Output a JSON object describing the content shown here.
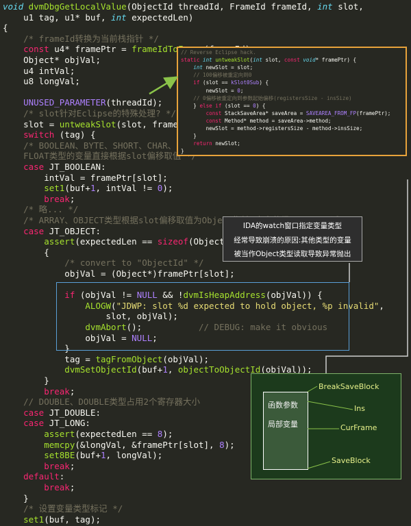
{
  "code_lines": [
    [
      [
        "ty",
        "void "
      ],
      [
        "fn",
        "dvmDbgGetLocalValue"
      ],
      [
        "tx",
        "(ObjectId threadId, FrameId frameId, "
      ],
      [
        "ty",
        "int"
      ],
      [
        "tx",
        " slot,"
      ]
    ],
    [
      [
        "tx",
        "    u1 tag, u1* buf, "
      ],
      [
        "ty",
        "int"
      ],
      [
        "tx",
        " expectedLen)"
      ]
    ],
    [
      [
        "tx",
        "{"
      ]
    ],
    [
      [
        "cm",
        "    /* frameId转换为当前栈指针 */"
      ]
    ],
    [
      [
        "kw",
        "    const "
      ],
      [
        "tx",
        "u4* framePtr = "
      ],
      [
        "fn",
        "frameIdToFrame"
      ],
      [
        "tx",
        "(frameId);"
      ]
    ],
    [
      [
        "tx",
        "    Object* objVal;"
      ]
    ],
    [
      [
        "tx",
        "    u4 intVal;"
      ]
    ],
    [
      [
        "tx",
        "    u8 longVal;"
      ]
    ],
    [
      [
        "tx",
        ""
      ]
    ],
    [
      [
        "mac",
        "    UNUSED_PARAMETER"
      ],
      [
        "tx",
        "(threadId);"
      ]
    ],
    [
      [
        "cm",
        "    /* slot针对Eclipse的特殊处理? */"
      ]
    ],
    [
      [
        "tx",
        "    slot = "
      ],
      [
        "fn",
        "untweakSlot"
      ],
      [
        "tx",
        "(slot, framePtr);"
      ]
    ],
    [
      [
        "kw",
        "    switch "
      ],
      [
        "tx",
        "(tag) {"
      ]
    ],
    [
      [
        "cm",
        "    /* BOOLEAN、BYTE、SHORT、CHAR、INT"
      ]
    ],
    [
      [
        "cm",
        "    FLOAT类型的变量直接根据slot偏移取值 */"
      ]
    ],
    [
      [
        "kw",
        "    case "
      ],
      [
        "tx",
        "JT_BOOLEAN:"
      ]
    ],
    [
      [
        "tx",
        "        intVal = framePtr[slot];"
      ]
    ],
    [
      [
        "fn",
        "        set1"
      ],
      [
        "tx",
        "(buf+"
      ],
      [
        "num",
        "1"
      ],
      [
        "tx",
        ", intVal != "
      ],
      [
        "num",
        "0"
      ],
      [
        "tx",
        ");"
      ]
    ],
    [
      [
        "kw",
        "        break"
      ],
      [
        "tx",
        ";"
      ]
    ],
    [
      [
        "cm",
        "    /* 略... */"
      ]
    ],
    [
      [
        "cm",
        "    /* ARRAY、OBJECT类型根据slot偏移取值为Object指针,查表获得ObjectId返回 */"
      ]
    ],
    [
      [
        "kw",
        "    case "
      ],
      [
        "tx",
        "JT_OBJECT:"
      ]
    ],
    [
      [
        "fn",
        "        assert"
      ],
      [
        "tx",
        "(expectedLen == "
      ],
      [
        "kw",
        "sizeof"
      ],
      [
        "tx",
        "(ObjectId));"
      ]
    ],
    [
      [
        "tx",
        "        {"
      ]
    ],
    [
      [
        "cm",
        "            /* convert to \"ObjectId\" */"
      ]
    ],
    [
      [
        "tx",
        "            objVal = (Object*)framePtr[slot];"
      ]
    ],
    [
      [
        "tx",
        ""
      ]
    ],
    [
      [
        "kw",
        "            if "
      ],
      [
        "tx",
        "(objVal != "
      ],
      [
        "num",
        "NULL"
      ],
      [
        "tx",
        " && !"
      ],
      [
        "fn",
        "dvmIsHeapAddress"
      ],
      [
        "tx",
        "(objVal)) {"
      ]
    ],
    [
      [
        "fn",
        "                ALOGW"
      ],
      [
        "tx",
        "("
      ],
      [
        "str",
        "\"JDWP: slot %d expected to hold object, %p invalid\""
      ],
      [
        "tx",
        ","
      ]
    ],
    [
      [
        "tx",
        "                    slot, objVal);"
      ]
    ],
    [
      [
        "fn",
        "                dvmAbort"
      ],
      [
        "tx",
        "();           "
      ],
      [
        "cm",
        "// DEBUG: make it obvious"
      ]
    ],
    [
      [
        "tx",
        "                objVal = "
      ],
      [
        "num",
        "NULL"
      ],
      [
        "tx",
        ";"
      ]
    ],
    [
      [
        "tx",
        "            }"
      ]
    ],
    [
      [
        "tx",
        "            tag = "
      ],
      [
        "fn",
        "tagFromObject"
      ],
      [
        "tx",
        "(objVal);"
      ]
    ],
    [
      [
        "fn",
        "            dvmSetObjectId"
      ],
      [
        "tx",
        "(buf+"
      ],
      [
        "num",
        "1"
      ],
      [
        "tx",
        ", "
      ],
      [
        "fn",
        "objectToObjectId"
      ],
      [
        "tx",
        "(objVal));"
      ]
    ],
    [
      [
        "tx",
        "        }"
      ]
    ],
    [
      [
        "kw",
        "        break"
      ],
      [
        "tx",
        ";"
      ]
    ],
    [
      [
        "cm",
        "    // DOUBLE、DOUBLE类型占用2个寄存器大小"
      ]
    ],
    [
      [
        "kw",
        "    case "
      ],
      [
        "tx",
        "JT_DOUBLE:"
      ]
    ],
    [
      [
        "kw",
        "    case "
      ],
      [
        "tx",
        "JT_LONG:"
      ]
    ],
    [
      [
        "fn",
        "        assert"
      ],
      [
        "tx",
        "(expectedLen == "
      ],
      [
        "num",
        "8"
      ],
      [
        "tx",
        ");"
      ]
    ],
    [
      [
        "fn",
        "        memcpy"
      ],
      [
        "tx",
        "(&longVal, &framePtr[slot], "
      ],
      [
        "num",
        "8"
      ],
      [
        "tx",
        ");"
      ]
    ],
    [
      [
        "fn",
        "        set8BE"
      ],
      [
        "tx",
        "(buf+"
      ],
      [
        "num",
        "1"
      ],
      [
        "tx",
        ", longVal);"
      ]
    ],
    [
      [
        "kw",
        "        break"
      ],
      [
        "tx",
        ";"
      ]
    ],
    [
      [
        "kw",
        "    default"
      ],
      [
        "tx",
        ":"
      ]
    ],
    [
      [
        "kw",
        "        break"
      ],
      [
        "tx",
        ";"
      ]
    ],
    [
      [
        "tx",
        "    }"
      ]
    ],
    [
      [
        "cm",
        "    /* 设置变量类型标记 */"
      ]
    ],
    [
      [
        "fn",
        "    set1"
      ],
      [
        "tx",
        "(buf, tag);"
      ]
    ]
  ],
  "inset_lines": [
    [
      [
        "cm",
        "// Reverse Eclipse hack."
      ]
    ],
    [
      [
        "kw",
        "static "
      ],
      [
        "ty",
        "int "
      ],
      [
        "fn",
        "untweakSlot"
      ],
      [
        "tx",
        "("
      ],
      [
        "ty",
        "int"
      ],
      [
        "tx",
        " slot, "
      ],
      [
        "kw",
        "const "
      ],
      [
        "ty",
        "void"
      ],
      [
        "tx",
        "* framePtr) {"
      ]
    ],
    [
      [
        "ty",
        "    int "
      ],
      [
        "tx",
        "newSlot = slot;"
      ]
    ],
    [
      [
        "cm",
        "    // 100偏移被重定向到0"
      ]
    ],
    [
      [
        "kw",
        "    if "
      ],
      [
        "tx",
        "(slot == "
      ],
      [
        "num",
        "kSlot0Sub"
      ],
      [
        "tx",
        ") {"
      ]
    ],
    [
      [
        "tx",
        "        newSlot = "
      ],
      [
        "num",
        "0"
      ],
      [
        "tx",
        ";"
      ]
    ],
    [
      [
        "cm",
        "    // 0偏移被重定向到参数起始偏移(registersSize - insSize)"
      ]
    ],
    [
      [
        "tx",
        "    } "
      ],
      [
        "kw",
        "else if "
      ],
      [
        "tx",
        "(slot == "
      ],
      [
        "num",
        "0"
      ],
      [
        "tx",
        ") {"
      ]
    ],
    [
      [
        "kw",
        "        const "
      ],
      [
        "tx",
        "StackSaveArea* saveArea = "
      ],
      [
        "num",
        "SAVEAREA_FROM_FP"
      ],
      [
        "tx",
        "(framePtr);"
      ]
    ],
    [
      [
        "kw",
        "        const "
      ],
      [
        "tx",
        "Method* method = saveArea->method;"
      ]
    ],
    [
      [
        "tx",
        "        newSlot = method->registersSize - method->insSize;"
      ]
    ],
    [
      [
        "tx",
        "    }"
      ]
    ],
    [
      [
        "kw",
        "    return "
      ],
      [
        "tx",
        "newSlot;"
      ]
    ],
    [
      [
        "tx",
        "}"
      ]
    ]
  ],
  "watch_note": {
    "line1": "IDA的watch窗口指定变量类型",
    "line2": "经常导致崩溃的原因:其他类型的变量",
    "line3": "被当作Object类型读取导致异常抛出"
  },
  "stack_diagram": {
    "params": "函数参数",
    "locals": "局部变量",
    "break_save_block": "BreakSaveBlock",
    "ins": "Ins",
    "cur_frame": "CurFrame",
    "save_block": "SaveBlock"
  },
  "colors": {
    "background": "#272822",
    "inset_border": "#e8a33b",
    "highlight_border": "#5aa0d8",
    "arrow": "#8bc34a",
    "connector": "#cfcfcf"
  }
}
